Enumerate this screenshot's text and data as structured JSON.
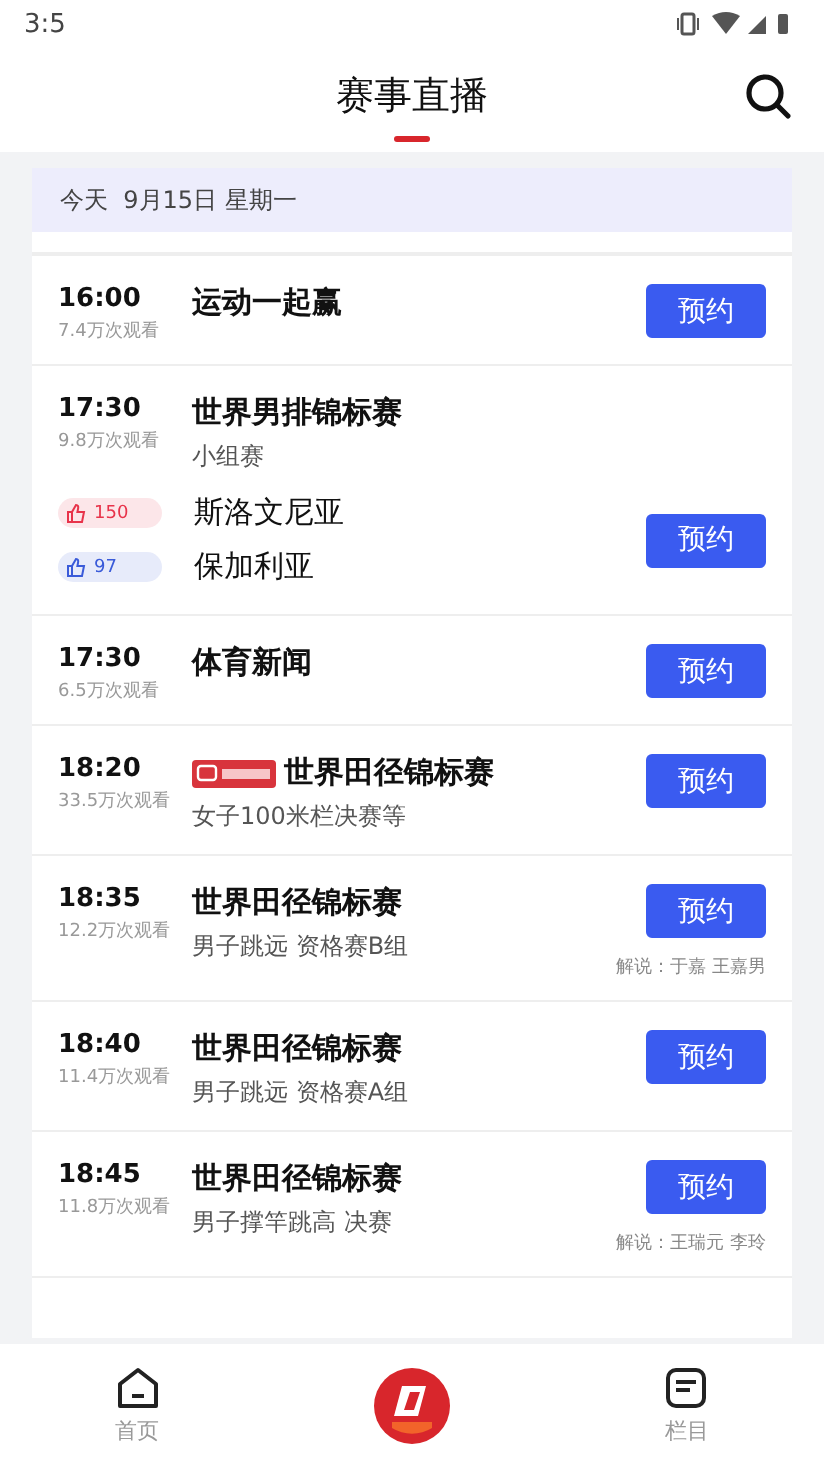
{
  "status_bar": {
    "time": "3:5"
  },
  "header": {
    "title": "赛事直播"
  },
  "date_bar": {
    "text": "今天  9月15日 星期一"
  },
  "schedule": [
    {
      "time": "16:00",
      "views": "7.4万次观看",
      "title": "运动一起赢",
      "button": "预约"
    },
    {
      "time": "17:30",
      "views": "9.8万次观看",
      "title": "世界男排锦标赛",
      "subtitle": "小组赛",
      "button": "预约",
      "teams": [
        {
          "name": "斯洛文尼亚",
          "votes": "150",
          "color": "#e8334a"
        },
        {
          "name": "保加利亚",
          "votes": "97",
          "color": "#3a5bd9"
        }
      ]
    },
    {
      "time": "17:30",
      "views": "6.5万次观看",
      "title": "体育新闻",
      "button": "预约"
    },
    {
      "time": "18:20",
      "views": "33.5万次观看",
      "title": "世界田径锦标赛",
      "subtitle": "女子100米栏决赛等",
      "live_badge": true,
      "button": "预约"
    },
    {
      "time": "18:35",
      "views": "12.2万次观看",
      "title": "世界田径锦标赛",
      "subtitle": "男子跳远 资格赛B组",
      "commentary": "解说：于嘉 王嘉男",
      "button": "预约"
    },
    {
      "time": "18:40",
      "views": "11.4万次观看",
      "title": "世界田径锦标赛",
      "subtitle": "男子跳远 资格赛A组",
      "button": "预约"
    },
    {
      "time": "18:45",
      "views": "11.8万次观看",
      "title": "世界田径锦标赛",
      "subtitle": "男子撑竿跳高 决赛",
      "commentary": "解说：王瑞元 李玲",
      "button": "预约"
    }
  ],
  "bottom_nav": [
    {
      "kind": "home",
      "label": "首页"
    },
    {
      "kind": "center"
    },
    {
      "kind": "columns",
      "label": "栏目"
    }
  ]
}
